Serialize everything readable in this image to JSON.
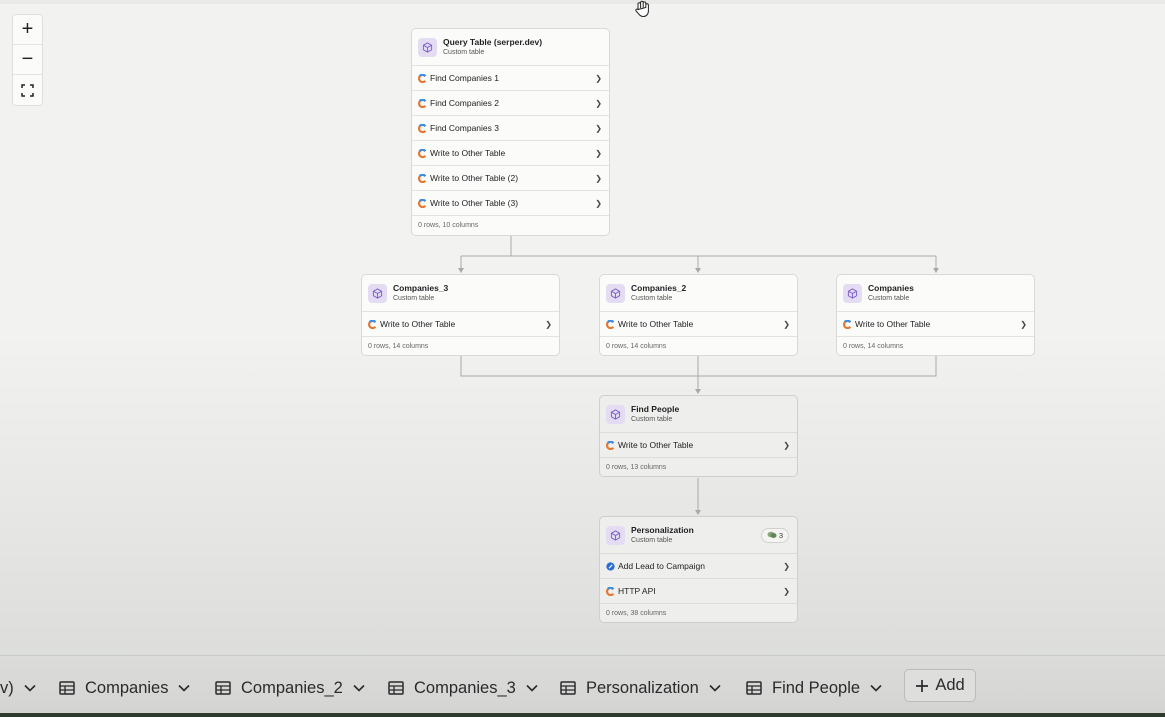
{
  "zoom": {
    "in": "+",
    "out": "−",
    "fit": "⛶"
  },
  "nodes": {
    "query_table": {
      "title": "Query Table (serper.dev)",
      "subtitle": "Custom table",
      "rows": [
        "Find Companies 1",
        "Find Companies 2",
        "Find Companies 3",
        "Write to Other Table",
        "Write to Other Table (2)",
        "Write to Other Table (3)"
      ],
      "footer": "0 rows, 10 columns"
    },
    "companies_3": {
      "title": "Companies_3",
      "subtitle": "Custom table",
      "rows": [
        "Write to Other Table"
      ],
      "footer": "0 rows, 14 columns"
    },
    "companies_2": {
      "title": "Companies_2",
      "subtitle": "Custom table",
      "rows": [
        "Write to Other Table"
      ],
      "footer": "0 rows, 14 columns"
    },
    "companies": {
      "title": "Companies",
      "subtitle": "Custom table",
      "rows": [
        "Write to Other Table"
      ],
      "footer": "0 rows, 14 columns"
    },
    "find_people": {
      "title": "Find People",
      "subtitle": "Custom table",
      "rows": [
        "Write to Other Table"
      ],
      "footer": "0 rows, 13 columns"
    },
    "personalization": {
      "title": "Personalization",
      "subtitle": "Custom table",
      "badge": "3",
      "rows": [
        "Add Lead to Campaign",
        "HTTP API"
      ],
      "footer": "0 rows, 38 columns"
    }
  },
  "tabs": [
    {
      "label": "v)"
    },
    {
      "label": "Companies"
    },
    {
      "label": "Companies_2"
    },
    {
      "label": "Companies_3"
    },
    {
      "label": "Personalization"
    },
    {
      "label": "Find People"
    }
  ],
  "add_label": "Add",
  "colors": {
    "canvas_bg": "#f2f3f1",
    "node_icon_bg": "#e4dcf3",
    "node_icon_fg": "#7b5cc4",
    "edge": "#a9aaa7",
    "accent_blue": "#2a6fd6"
  }
}
